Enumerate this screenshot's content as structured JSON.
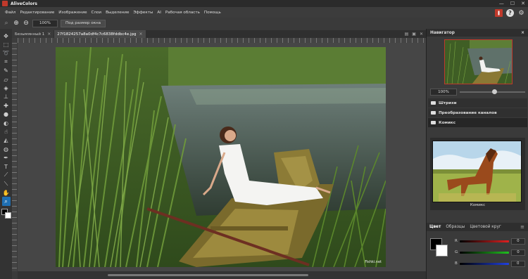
{
  "app": {
    "title": "AliveColors"
  },
  "window_buttons": {
    "minimize": "—",
    "maximize": "☐",
    "close": "✕"
  },
  "menu": [
    "Файл",
    "Редактирование",
    "Изображение",
    "Слои",
    "Выделение",
    "Эффекты",
    "AI",
    "Рабочая область",
    "Помощь"
  ],
  "options": {
    "zoom_value": "100%",
    "fit_label": "Под размер окна"
  },
  "tabs": [
    {
      "label": "Безымянный 1",
      "close": "×",
      "active": false
    },
    {
      "label": "27f1824257a8a0df4c7c6838fddbc4e.jpg",
      "close": "×",
      "active": true
    }
  ],
  "canvas": {
    "watermark": "Fishki.net"
  },
  "navigator": {
    "title": "Навигатор",
    "close": "×",
    "zoom_value": "100%",
    "zoom_level_percent": 100
  },
  "panels": [
    {
      "label": "Штрихи",
      "open": false
    },
    {
      "label": "Преобразование каналов",
      "open": false
    },
    {
      "label": "Комикс",
      "open": true
    }
  ],
  "preset": {
    "label": "Комикс"
  },
  "color_panel": {
    "tabs": [
      "Цвет",
      "Образцы",
      "Цветовой круг"
    ],
    "menu_icon": "≡",
    "channels": [
      {
        "label": "R",
        "value": "0",
        "color": "#e02020"
      },
      {
        "label": "G",
        "value": "0",
        "color": "#20c020"
      },
      {
        "label": "B",
        "value": "0",
        "color": "#2040e0"
      }
    ]
  },
  "colors": {
    "accent": "#1f6fb2",
    "brand_red": "#c0392b"
  }
}
